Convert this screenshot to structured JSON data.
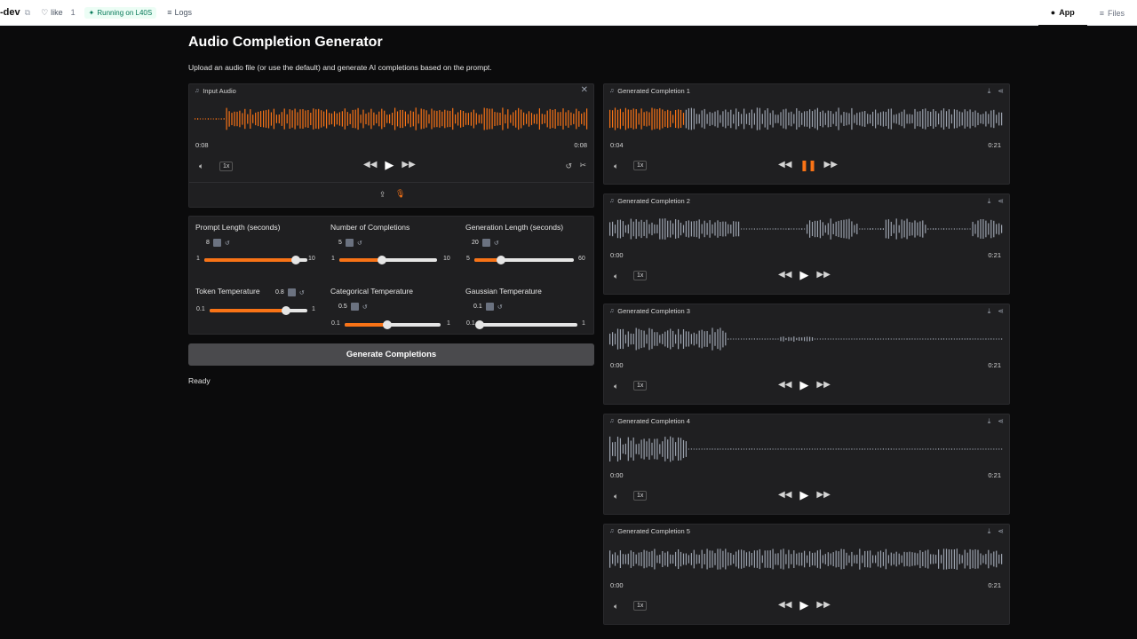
{
  "topbar": {
    "repo": "-dev",
    "like_label": "like",
    "like_count": "1",
    "running_label": "Running on L40S",
    "logs_label": "Logs",
    "tab_app": "App",
    "tab_files": "Files"
  },
  "page": {
    "title": "Audio Completion Generator",
    "subtitle": "Upload an audio file (or use the default) and generate AI completions based on the prompt."
  },
  "input_audio": {
    "label": "Input Audio",
    "time_left": "0:08",
    "time_right": "0:08",
    "speed": "1x",
    "wave_progress": 1.0
  },
  "sliders": [
    {
      "label": "Prompt Length (seconds)",
      "value": "8",
      "min": "1",
      "max": "10",
      "fraction": 0.89
    },
    {
      "label": "Number of Completions",
      "value": "5",
      "min": "1",
      "max": "10",
      "fraction": 0.44
    },
    {
      "label": "Generation Length (seconds)",
      "value": "20",
      "min": "5",
      "max": "60",
      "fraction": 0.27
    },
    {
      "label": "Token Temperature",
      "value": "0.8",
      "min": "0.1",
      "max": "1",
      "fraction": 0.78
    },
    {
      "label": "Categorical Temperature",
      "value": "0.5",
      "min": "0.1",
      "max": "1",
      "fraction": 0.44
    },
    {
      "label": "Gaussian Temperature",
      "value": "0.1",
      "min": "0.1",
      "max": "1",
      "fraction": 0.0
    }
  ],
  "generate_label": "Generate Completions",
  "status": "Ready",
  "completions": [
    {
      "label": "Generated Completion 1",
      "time_left": "0:04",
      "time_right": "0:21",
      "speed": "1x",
      "progress": 0.19,
      "playing": true
    },
    {
      "label": "Generated Completion 2",
      "time_left": "0:00",
      "time_right": "0:21",
      "speed": "1x",
      "progress": 0.0,
      "playing": false
    },
    {
      "label": "Generated Completion 3",
      "time_left": "0:00",
      "time_right": "0:21",
      "speed": "1x",
      "progress": 0.0,
      "playing": false
    },
    {
      "label": "Generated Completion 4",
      "time_left": "0:00",
      "time_right": "0:21",
      "speed": "1x",
      "progress": 0.0,
      "playing": false
    },
    {
      "label": "Generated Completion 5",
      "time_left": "0:00",
      "time_right": "0:21",
      "speed": "1x",
      "progress": 0.0,
      "playing": false
    }
  ],
  "colors": {
    "accent": "#f97316",
    "wave_idle": "#9ca3af",
    "panel": "#1f1f21"
  }
}
